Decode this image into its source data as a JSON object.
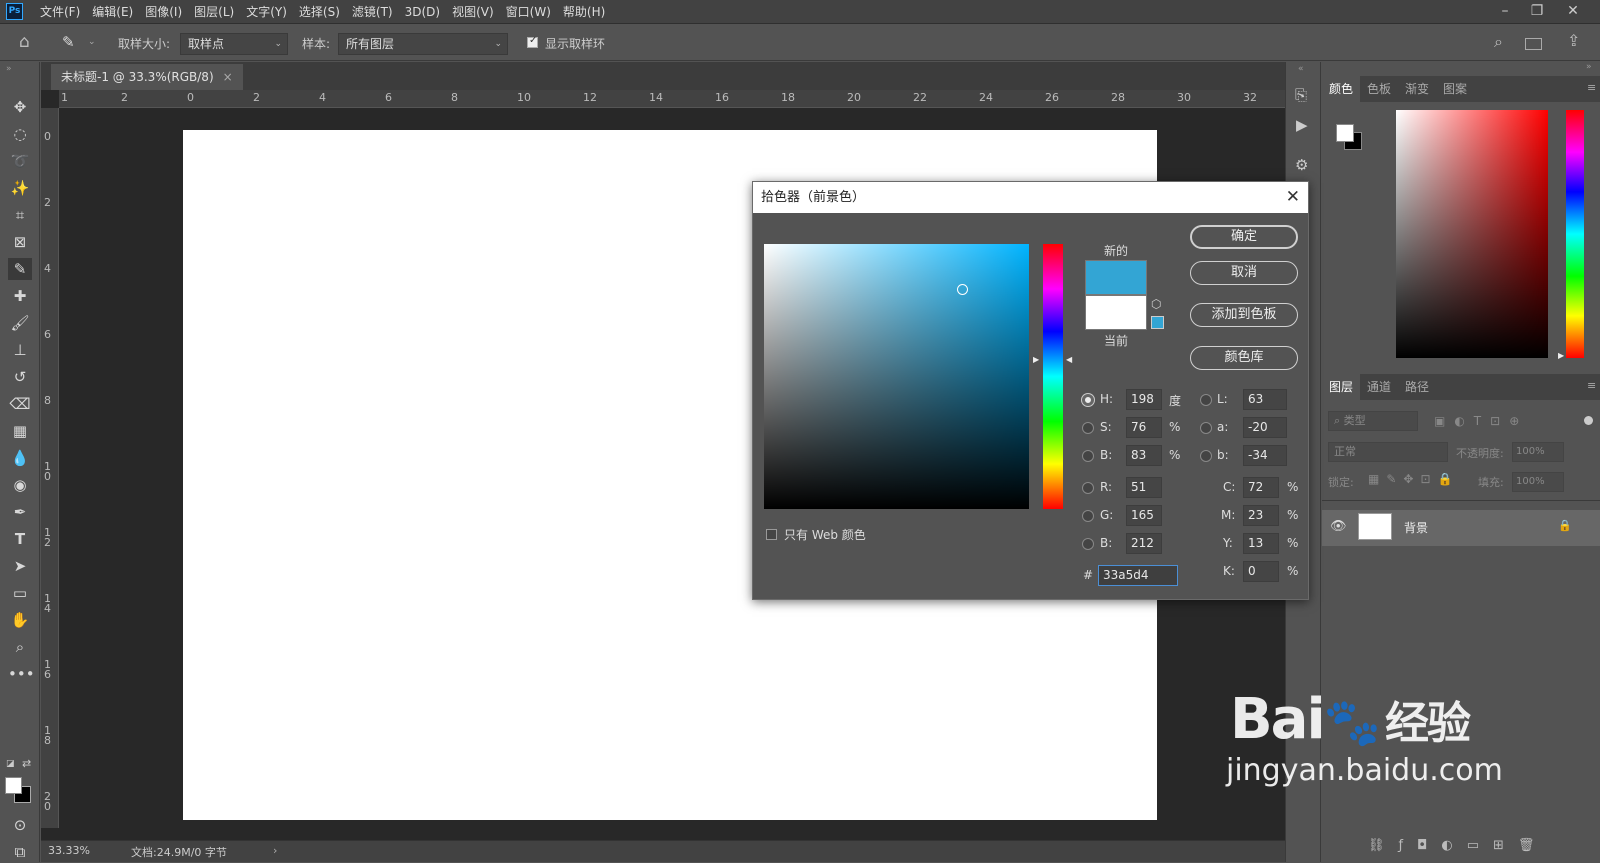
{
  "menubar": {
    "logo": "Ps",
    "items": [
      "文件(F)",
      "编辑(E)",
      "图像(I)",
      "图层(L)",
      "文字(Y)",
      "选择(S)",
      "滤镜(T)",
      "3D(D)",
      "视图(V)",
      "窗口(W)",
      "帮助(H)"
    ]
  },
  "options": {
    "sample_size_label": "取样大小:",
    "sample_size_value": "取样点",
    "sample_label": "样本:",
    "sample_value": "所有图层",
    "show_ring_label": "显示取样环"
  },
  "document": {
    "tab_title": "未标题-1 @ 33.3%(RGB/8)",
    "zoom": "33.33%",
    "doc_info": "文档:24.9M/0 字节"
  },
  "rulers": {
    "h": [
      "1",
      "2",
      "0",
      "2",
      "4",
      "6",
      "8",
      "10",
      "12",
      "14",
      "16",
      "18",
      "20",
      "22",
      "24",
      "26",
      "28",
      "30",
      "32"
    ],
    "v": [
      "0",
      "2",
      "4",
      "6",
      "8",
      "1\n0",
      "1\n2",
      "1\n4",
      "1\n6",
      "1\n8",
      "2\n0"
    ]
  },
  "color_panel": {
    "tabs": [
      "颜色",
      "色板",
      "渐变",
      "图案"
    ]
  },
  "layers_panel": {
    "tabs": [
      "图层",
      "通道",
      "路径"
    ],
    "filter_placeholder": "类型",
    "blend_mode": "正常",
    "opacity_label": "不透明度:",
    "opacity_value": "100%",
    "lock_label": "锁定:",
    "fill_label": "填充:",
    "fill_value": "100%",
    "layer_name": "背景"
  },
  "dialog": {
    "title": "拾色器（前景色）",
    "new_label": "新的",
    "current_label": "当前",
    "new_color": "#33a5d4",
    "current_color": "#ffffff",
    "buttons": {
      "ok": "确定",
      "cancel": "取消",
      "add_swatch": "添加到色板",
      "libraries": "颜色库"
    },
    "web_only_label": "只有 Web 颜色",
    "hsb": [
      {
        "label": "H:",
        "value": "198",
        "unit": "度"
      },
      {
        "label": "S:",
        "value": "76",
        "unit": "%"
      },
      {
        "label": "B:",
        "value": "83",
        "unit": "%"
      }
    ],
    "rgb": [
      {
        "label": "R:",
        "value": "51"
      },
      {
        "label": "G:",
        "value": "165"
      },
      {
        "label": "B:",
        "value": "212"
      }
    ],
    "lab": [
      {
        "label": "L:",
        "value": "63"
      },
      {
        "label": "a:",
        "value": "-20"
      },
      {
        "label": "b:",
        "value": "-34"
      }
    ],
    "cmyk": [
      {
        "label": "C:",
        "value": "72",
        "unit": "%"
      },
      {
        "label": "M:",
        "value": "23",
        "unit": "%"
      },
      {
        "label": "Y:",
        "value": "13",
        "unit": "%"
      },
      {
        "label": "K:",
        "value": "0",
        "unit": "%"
      }
    ],
    "hex_label": "#",
    "hex_value": "33a5d4"
  },
  "watermark": {
    "brand": "Bai",
    "brand_cn": "经验",
    "url": "jingyan.baidu.com"
  }
}
